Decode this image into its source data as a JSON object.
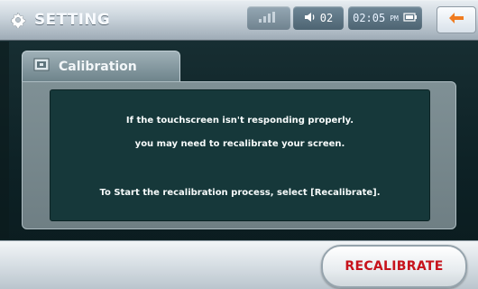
{
  "header": {
    "title": "SETTING",
    "status": {
      "volume": "02",
      "time": "02:05",
      "ampm": "PM"
    }
  },
  "tab": {
    "label": "Calibration"
  },
  "panel": {
    "lines": [
      "If the touchscreen isn't responding properly.",
      "you may need to recalibrate your screen.",
      "To Start the recalibration process, select [Recalibrate]."
    ]
  },
  "footer": {
    "recalibrate_label": "RECALIBRATE"
  },
  "icons": {
    "settings": "gear-icon",
    "gps": "gps-signal-icon",
    "volume": "speaker-icon",
    "clock": "clock-icon",
    "battery": "battery-icon",
    "back": "back-arrow-icon",
    "tab": "screen-icon"
  },
  "colors": {
    "accent_orange": "#f07c20",
    "button_text_red": "#c7131c",
    "panel_dark": "#16383a"
  }
}
